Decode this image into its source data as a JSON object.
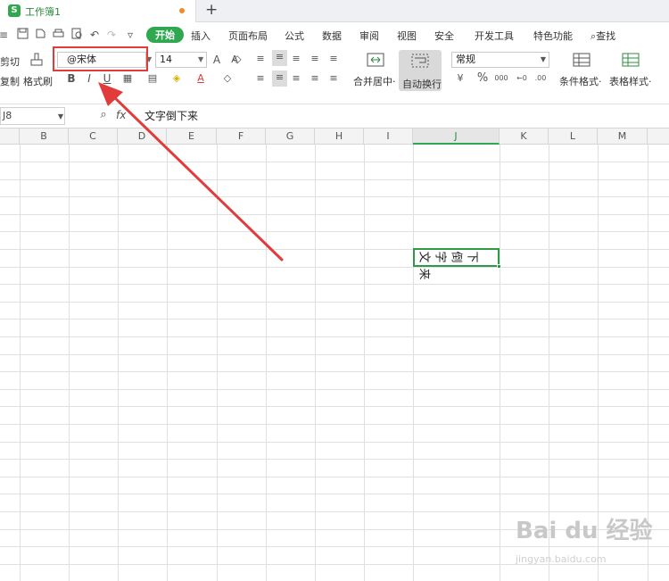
{
  "tabbar": {
    "logo": "S",
    "title": "工作簿1",
    "new_tab": "+"
  },
  "quick_access": [
    "≡",
    "⎙",
    "⌕",
    "⎌",
    "↶",
    "↷",
    "▿"
  ],
  "menus": [
    "开始",
    "插入",
    "页面布局",
    "公式",
    "数据",
    "审阅",
    "视图",
    "安全",
    "开发工具",
    "特色功能"
  ],
  "search_label": "查找",
  "clipboard": {
    "cut": "剪切",
    "copy": "复制",
    "format_painter": "格式刷"
  },
  "font": {
    "name": "@宋体",
    "size": "14",
    "bold": "B",
    "italic": "I",
    "underline": "U"
  },
  "align": {
    "merge_label": "合并居中·",
    "wrap_label": "自动换行"
  },
  "number": {
    "format": "常规",
    "percent": "%",
    "thousands": "000"
  },
  "styles": {
    "conditional": "条件格式·",
    "table_style": "表格样式·"
  },
  "formula_bar": {
    "cell_ref": "J8",
    "fx": "fx",
    "value": "文字倒下来"
  },
  "columns": [
    "B",
    "C",
    "D",
    "E",
    "F",
    "G",
    "H",
    "I",
    "J",
    "K",
    "L",
    "M"
  ],
  "selected_cell": {
    "chars": [
      "文",
      "字",
      "倒",
      "下",
      "来"
    ]
  },
  "watermark": {
    "main": "Bai du 经验",
    "sub": "jingyan.baidu.com"
  },
  "colors": {
    "accent": "#2fa84f",
    "annotation": "#e23b3b"
  }
}
